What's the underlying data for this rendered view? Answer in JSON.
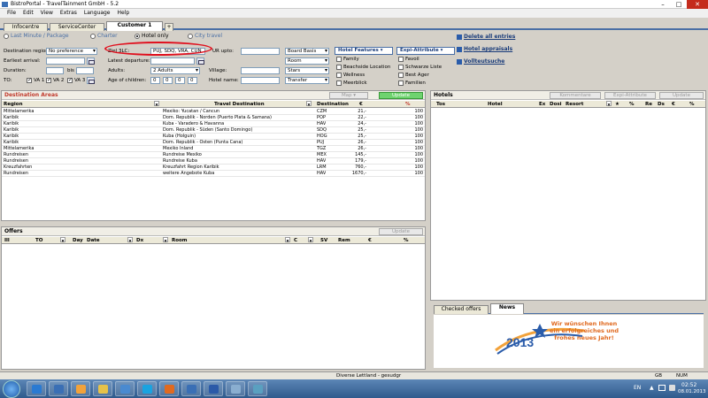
{
  "window": {
    "title": "BistroPortal - TravelTainment GmbH - 5.2"
  },
  "menu": [
    "File",
    "Edit",
    "View",
    "Extras",
    "Language",
    "Help"
  ],
  "tabs": [
    "Infocentre",
    "ServiceCenter",
    "Customer 1"
  ],
  "radio_options": [
    {
      "label": "Last Minute / Package",
      "selected": false
    },
    {
      "label": "Charter",
      "selected": false
    },
    {
      "label": "Hotel only",
      "selected": true
    },
    {
      "label": "City travel",
      "selected": false
    }
  ],
  "delete_link": "Delete all entries",
  "hotel_appraisals": "Hotel appraisals",
  "vollreiseuche": "Vollteutsuche",
  "form": {
    "destination_region_label": "Destination region:",
    "destination_region_value": "No preference",
    "zielrlc_label": "Ziel 3LC:",
    "zielrlc_value": "PUJ, SDQ, VRA, CUN",
    "ur_upto_label": "UR upto:",
    "earliest_arrival_label": "Earliest arrival:",
    "latest_departure_label": "Latest departure:",
    "duration_label": "Duration:",
    "bis_label": "bis",
    "adults_label": "Adults:",
    "adults_value": "2 Adults",
    "village_label": "Village:",
    "to_label": "TO:",
    "age_children_label": "Age of children:",
    "age_children_values": [
      "0",
      "0",
      "0",
      "0"
    ],
    "hotel_name_label": "Hotel name:",
    "va_options": [
      {
        "label": "VA 1",
        "checked": true
      },
      {
        "label": "VA 2",
        "checked": true
      },
      {
        "label": "VA 3",
        "checked": true
      }
    ],
    "board_basis": "Board Basis",
    "room": "Room",
    "stars": "Stars",
    "transfer": "Transfer",
    "hotel_features": "Hotel Features",
    "expi_attribute": "Expi-Attribute",
    "features_col1": [
      "Family",
      "Beachside Location",
      "Wellness",
      "Meerblick"
    ],
    "features_col2": [
      "Favoil",
      "Schwarze Liste",
      "Best Ager",
      "Familien"
    ]
  },
  "destination_areas": {
    "title": "Destination Areas",
    "map_btn": "Map",
    "update_btn": "Update",
    "columns": [
      "Region",
      "Travel Destination",
      "Destination",
      "€",
      "%"
    ],
    "rows": [
      [
        "Mittelamerika",
        "Mexiko: Yucatan / Cancun",
        "CZM",
        "21,-",
        "100"
      ],
      [
        "Karibik",
        "Dom. Republik - Norden (Puerto Plata & Samana)",
        "POP",
        "22,-",
        "100"
      ],
      [
        "Karibik",
        "Kuba - Varadero & Havanna",
        "HAV",
        "24,-",
        "100"
      ],
      [
        "Karibik",
        "Dom. Republik - Süden (Santo Domingo)",
        "SDQ",
        "25,-",
        "100"
      ],
      [
        "Karibik",
        "Kuba (Holguin)",
        "HOG",
        "25,-",
        "100"
      ],
      [
        "Karibik",
        "Dom. Republik - Osten (Punta Cana)",
        "PUJ",
        "26,-",
        "100"
      ],
      [
        "Mittelamerika",
        "Mexiko Inland",
        "TGZ",
        "26,-",
        "100"
      ],
      [
        "Rundreisen",
        "Rundreise Mexiko",
        "MEX",
        "145,-",
        "100"
      ],
      [
        "Rundreisen",
        "Rundreise Kuba",
        "HAV",
        "179,-",
        "100"
      ],
      [
        "Kreuzfahrten",
        "Kreuzfahrt Region Karibik",
        "LRM",
        "760,-",
        "100"
      ],
      [
        "Rundreisen",
        "weitere Angebote Kuba",
        "HAV",
        "1670,-",
        "100"
      ]
    ]
  },
  "hotels": {
    "title": "Hotels",
    "buttons": [
      "Kommentare",
      "Expi-Attribute",
      "Update"
    ],
    "columns": [
      "Tos",
      "Hotel",
      "Ex",
      "Dosi",
      "Resort",
      "★",
      "%",
      "Re",
      "Ds",
      "€",
      "%"
    ]
  },
  "offers": {
    "title": "Offers",
    "update_btn": "Update",
    "columns": [
      "Ill",
      "TO",
      "Day",
      "Date",
      "Dx",
      "Room",
      "C",
      "SV",
      "Rem",
      "€",
      "%"
    ]
  },
  "bottom_tabs": [
    "Checked offers",
    "News"
  ],
  "news": {
    "year": "2013",
    "text": "Wir wünschen Ihnen ein erfolgreiches und frohes neues Jahr!"
  },
  "status": {
    "center": "Diverse Lettland - gesudgr",
    "gb": "GB",
    "num": "NUM"
  },
  "taskbar": {
    "lang": "EN",
    "time": "02:52",
    "date": "08.01.2013",
    "apps": [
      {
        "name": "ie-icon",
        "color": "#2a7ad2"
      },
      {
        "name": "amadeus-icon",
        "color": "#3a6fb5"
      },
      {
        "name": "media-player-icon",
        "color": "#f2a23a"
      },
      {
        "name": "explorer-icon",
        "color": "#e6c24a"
      },
      {
        "name": "outlook-icon",
        "color": "#4a8ad0"
      },
      {
        "name": "skype-icon",
        "color": "#1aa3e0"
      },
      {
        "name": "firefox-icon",
        "color": "#e06a20"
      },
      {
        "name": "amadeus2-icon",
        "color": "#3a6fb5"
      },
      {
        "name": "word-icon",
        "color": "#2b5aa8"
      },
      {
        "name": "app-icon",
        "color": "#8aaed0"
      },
      {
        "name": "app2-icon",
        "color": "#5aa0c0"
      }
    ]
  }
}
